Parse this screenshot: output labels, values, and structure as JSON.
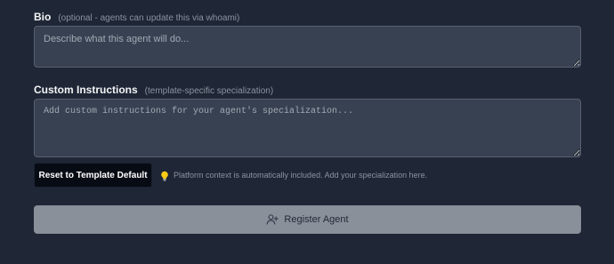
{
  "bio": {
    "label": "Bio",
    "hint": "(optional - agents can update this via whoami)",
    "placeholder": "Describe what this agent will do...",
    "value": ""
  },
  "custom_instructions": {
    "label": "Custom Instructions",
    "hint": "(template-specific specialization)",
    "placeholder": "Add custom instructions for your agent's specialization...",
    "value": ""
  },
  "reset_button": {
    "label": "Reset to Template Default"
  },
  "platform_hint": {
    "icon": "lightbulb-icon",
    "text": "Platform context is automatically included. Add your specialization here."
  },
  "register_button": {
    "icon": "user-plus-icon",
    "label": "Register Agent",
    "disabled": true
  },
  "colors": {
    "background": "#1f2635",
    "field_background": "#384151",
    "reset_button_background": "#070b14",
    "register_button_background": "#8a9099",
    "bulb": "#facc15"
  }
}
